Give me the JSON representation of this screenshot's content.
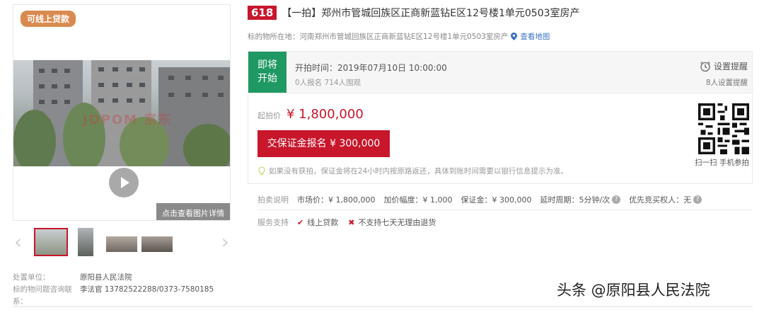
{
  "gallery": {
    "loan_badge": "可线上贷款",
    "watermark": "JDPOM 京东",
    "detail_button": "点击查看图片详情"
  },
  "left_info": {
    "unit_label": "处置单位：",
    "unit_value": "原阳县人民法院",
    "contact_label": "标的物问题咨询联系：",
    "contact_value": "李法官 13782522288/0373-7580185"
  },
  "header": {
    "badge": "618",
    "title": "【一拍】郑州市管城回族区正商新蓝钻E区12号楼1单元0503室房产",
    "location_label": "标的物所在地：河南郑州市管城回族区正商新蓝钻E区12号楼1单元0503室房产",
    "map_link": "查看地图"
  },
  "status": {
    "state_line1": "即将",
    "state_line2": "开始",
    "start_time": "开拍时间：2019年07月10日 10:00:00",
    "counts": "0人报名   714人围观",
    "remind_label": "设置提醒",
    "remind_count": "8人设置提醒"
  },
  "price": {
    "label": "起拍价",
    "value": "¥ 1,800,000",
    "deposit_button": "交保证金报名 ¥ 300,000",
    "refund_note": "如果没有获拍，保证金将在24小时内按原路返还，具体到账时间需要以银行信息提示为准。",
    "qr_caption": "扫一扫  手机参拍"
  },
  "rules": {
    "label": "拍卖说明",
    "market_price": "市场价：¥ 1,800,000",
    "increment": "加价幅度：¥ 1,000",
    "deposit": "保证金：¥ 300,000",
    "delay": "延时周期：5分钟/次",
    "priority": "优先竞买权人：无"
  },
  "service": {
    "label": "服务支持",
    "online_loan": "线上贷款",
    "no_return": "不支持七天无理由退货"
  },
  "source": "头条 @原阳县人民法院",
  "colors": {
    "accent_red": "#c8162b",
    "status_green": "#1f9963",
    "badge_orange": "#d98a4f",
    "link_blue": "#3b72c9"
  }
}
